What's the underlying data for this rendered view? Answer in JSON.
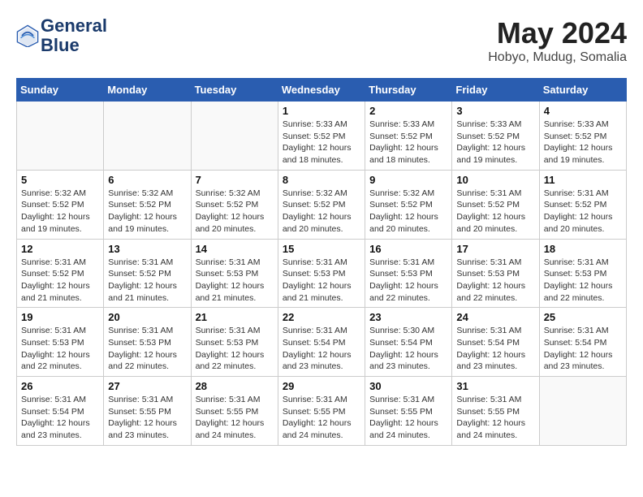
{
  "logo": {
    "text_general": "General",
    "text_blue": "Blue"
  },
  "header": {
    "month": "May 2024",
    "location": "Hobyo, Mudug, Somalia"
  },
  "weekdays": [
    "Sunday",
    "Monday",
    "Tuesday",
    "Wednesday",
    "Thursday",
    "Friday",
    "Saturday"
  ],
  "weeks": [
    [
      {
        "day": "",
        "info": ""
      },
      {
        "day": "",
        "info": ""
      },
      {
        "day": "",
        "info": ""
      },
      {
        "day": "1",
        "info": "Sunrise: 5:33 AM\nSunset: 5:52 PM\nDaylight: 12 hours\nand 18 minutes."
      },
      {
        "day": "2",
        "info": "Sunrise: 5:33 AM\nSunset: 5:52 PM\nDaylight: 12 hours\nand 18 minutes."
      },
      {
        "day": "3",
        "info": "Sunrise: 5:33 AM\nSunset: 5:52 PM\nDaylight: 12 hours\nand 19 minutes."
      },
      {
        "day": "4",
        "info": "Sunrise: 5:33 AM\nSunset: 5:52 PM\nDaylight: 12 hours\nand 19 minutes."
      }
    ],
    [
      {
        "day": "5",
        "info": "Sunrise: 5:32 AM\nSunset: 5:52 PM\nDaylight: 12 hours\nand 19 minutes."
      },
      {
        "day": "6",
        "info": "Sunrise: 5:32 AM\nSunset: 5:52 PM\nDaylight: 12 hours\nand 19 minutes."
      },
      {
        "day": "7",
        "info": "Sunrise: 5:32 AM\nSunset: 5:52 PM\nDaylight: 12 hours\nand 20 minutes."
      },
      {
        "day": "8",
        "info": "Sunrise: 5:32 AM\nSunset: 5:52 PM\nDaylight: 12 hours\nand 20 minutes."
      },
      {
        "day": "9",
        "info": "Sunrise: 5:32 AM\nSunset: 5:52 PM\nDaylight: 12 hours\nand 20 minutes."
      },
      {
        "day": "10",
        "info": "Sunrise: 5:31 AM\nSunset: 5:52 PM\nDaylight: 12 hours\nand 20 minutes."
      },
      {
        "day": "11",
        "info": "Sunrise: 5:31 AM\nSunset: 5:52 PM\nDaylight: 12 hours\nand 20 minutes."
      }
    ],
    [
      {
        "day": "12",
        "info": "Sunrise: 5:31 AM\nSunset: 5:52 PM\nDaylight: 12 hours\nand 21 minutes."
      },
      {
        "day": "13",
        "info": "Sunrise: 5:31 AM\nSunset: 5:52 PM\nDaylight: 12 hours\nand 21 minutes."
      },
      {
        "day": "14",
        "info": "Sunrise: 5:31 AM\nSunset: 5:53 PM\nDaylight: 12 hours\nand 21 minutes."
      },
      {
        "day": "15",
        "info": "Sunrise: 5:31 AM\nSunset: 5:53 PM\nDaylight: 12 hours\nand 21 minutes."
      },
      {
        "day": "16",
        "info": "Sunrise: 5:31 AM\nSunset: 5:53 PM\nDaylight: 12 hours\nand 22 minutes."
      },
      {
        "day": "17",
        "info": "Sunrise: 5:31 AM\nSunset: 5:53 PM\nDaylight: 12 hours\nand 22 minutes."
      },
      {
        "day": "18",
        "info": "Sunrise: 5:31 AM\nSunset: 5:53 PM\nDaylight: 12 hours\nand 22 minutes."
      }
    ],
    [
      {
        "day": "19",
        "info": "Sunrise: 5:31 AM\nSunset: 5:53 PM\nDaylight: 12 hours\nand 22 minutes."
      },
      {
        "day": "20",
        "info": "Sunrise: 5:31 AM\nSunset: 5:53 PM\nDaylight: 12 hours\nand 22 minutes."
      },
      {
        "day": "21",
        "info": "Sunrise: 5:31 AM\nSunset: 5:53 PM\nDaylight: 12 hours\nand 22 minutes."
      },
      {
        "day": "22",
        "info": "Sunrise: 5:31 AM\nSunset: 5:54 PM\nDaylight: 12 hours\nand 23 minutes."
      },
      {
        "day": "23",
        "info": "Sunrise: 5:30 AM\nSunset: 5:54 PM\nDaylight: 12 hours\nand 23 minutes."
      },
      {
        "day": "24",
        "info": "Sunrise: 5:31 AM\nSunset: 5:54 PM\nDaylight: 12 hours\nand 23 minutes."
      },
      {
        "day": "25",
        "info": "Sunrise: 5:31 AM\nSunset: 5:54 PM\nDaylight: 12 hours\nand 23 minutes."
      }
    ],
    [
      {
        "day": "26",
        "info": "Sunrise: 5:31 AM\nSunset: 5:54 PM\nDaylight: 12 hours\nand 23 minutes."
      },
      {
        "day": "27",
        "info": "Sunrise: 5:31 AM\nSunset: 5:55 PM\nDaylight: 12 hours\nand 23 minutes."
      },
      {
        "day": "28",
        "info": "Sunrise: 5:31 AM\nSunset: 5:55 PM\nDaylight: 12 hours\nand 24 minutes."
      },
      {
        "day": "29",
        "info": "Sunrise: 5:31 AM\nSunset: 5:55 PM\nDaylight: 12 hours\nand 24 minutes."
      },
      {
        "day": "30",
        "info": "Sunrise: 5:31 AM\nSunset: 5:55 PM\nDaylight: 12 hours\nand 24 minutes."
      },
      {
        "day": "31",
        "info": "Sunrise: 5:31 AM\nSunset: 5:55 PM\nDaylight: 12 hours\nand 24 minutes."
      },
      {
        "day": "",
        "info": ""
      }
    ]
  ]
}
